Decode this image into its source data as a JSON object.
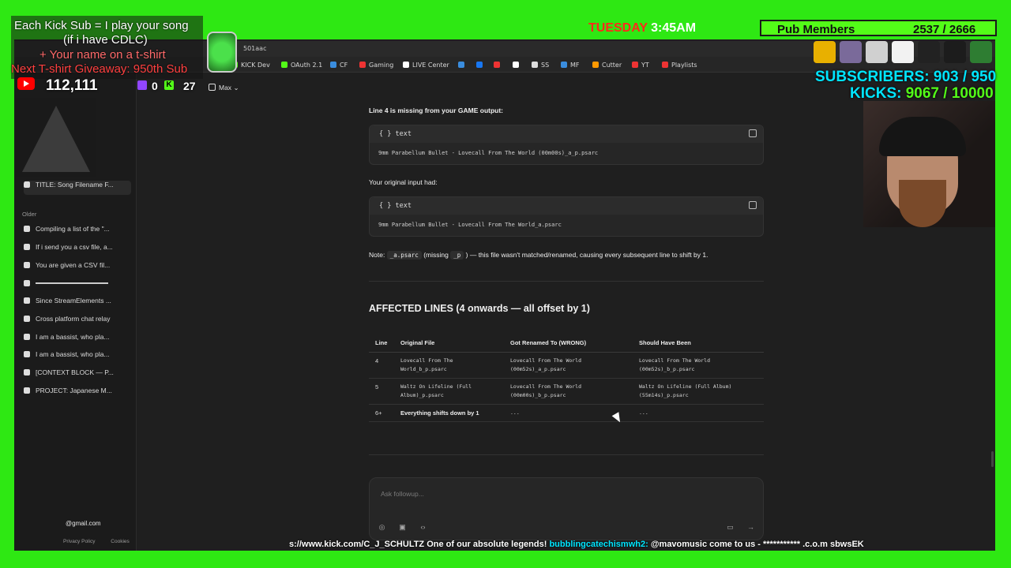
{
  "browser": {
    "url_fragment": "501aac",
    "bookmarks": [
      "KICK Dev",
      "OAuth 2.1",
      "CF",
      "Gaming",
      "LIVE Center",
      "SS",
      "MF",
      "Cutter",
      "YT",
      "Playlists"
    ]
  },
  "sidebar": {
    "items_recent": [
      {
        "label": "TITLE: Song Filename F..."
      }
    ],
    "section_older": "Older",
    "items_older": [
      {
        "label": "Compiling a list of the \"..."
      },
      {
        "label": "If i send you a csv file, a..."
      },
      {
        "label": "You are given a CSV fil..."
      },
      {
        "label": ""
      },
      {
        "label": "Since StreamElements ..."
      },
      {
        "label": "Cross platform chat relay"
      },
      {
        "label": "I am a bassist, who pla..."
      },
      {
        "label": "I am a bassist, who pla..."
      },
      {
        "label": "[CONTEXT BLOCK — P..."
      },
      {
        "label": "PROJECT: Japanese M..."
      }
    ],
    "email": "@gmail.com",
    "footer_privacy": "Privacy Policy",
    "footer_cookies": "Cookies"
  },
  "model_selector": "Max",
  "chat": {
    "p1": "Line 4 is missing from your GAME output:",
    "code1_lang": "text",
    "code1": "9mm Parabellum Bullet - Lovecall From The World (00m00s)_a_p.psarc",
    "p2": "Your original input had:",
    "code2_lang": "text",
    "code2": "9mm Parabellum Bullet - Lovecall From The World_a.psarc",
    "note_label": "Note:",
    "note_code1": "_a.psarc",
    "note_mid": "(missing",
    "note_code2": "_p",
    "note_rest": ") — this file wasn't matched/renamed, causing every subsequent line to shift by 1.",
    "heading": "AFFECTED LINES (4 onwards — all offset by 1)",
    "table": {
      "headers": [
        "Line",
        "Original File",
        "Got Renamed To (WRONG)",
        "Should Have Been"
      ],
      "rows": [
        [
          "4",
          "Lovecall From The World_b_p.psarc",
          "Lovecall From The World (00m52s)_a_p.psarc",
          "Lovecall From The World (00m52s)_b_p.psarc"
        ],
        [
          "5",
          "Waltz On Lifeline (Full Album)_p.psarc",
          "Lovecall From The World (00m00s)_b_p.psarc",
          "Waltz On Lifeline (Full Album) (55m14s)_p.psarc"
        ],
        [
          "6+",
          "Everything shifts down by 1",
          "...",
          "..."
        ]
      ]
    },
    "followup_placeholder": "Ask followup..."
  },
  "overlay": {
    "line1": "Each Kick Sub = I play your song",
    "line2": "(if i have CDLC)",
    "line3": "+ Your name on a t-shirt",
    "line4": "Next T-shirt Giveaway: 950th Sub",
    "youtube_count": "112,111",
    "twitch_count": "0",
    "kick_count": "27",
    "day": "TUESDAY",
    "time": "3:45AM",
    "pub_label": "Pub Members",
    "pub_count": "2537 / 2666",
    "subscribers": "SUBSCRIBERS: 903 / 950",
    "kicks_label": "KICKS:",
    "kicks_value": "9067 / 10000",
    "ticker_pre": "s://www.kick.com/C_J_SCHULTZ One of our absolute legends!",
    "ticker_user": "bubblingcatechismwh2:",
    "ticker_msg": "@mavomusic come to us - *********** .c.o.m sbwsEK"
  }
}
